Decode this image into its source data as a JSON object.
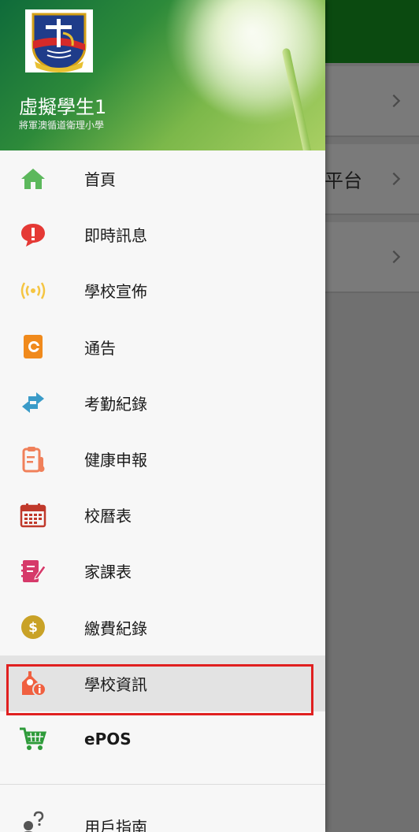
{
  "background": {
    "cards": [
      {
        "text": ""
      },
      {
        "text": "平台"
      },
      {
        "text": ""
      }
    ]
  },
  "drawer": {
    "user_name": "虛擬學生1",
    "school_name": "將軍澳循道衛理小學",
    "menu": [
      {
        "label": "首頁",
        "icon": "home-icon",
        "color": "#5cb85c"
      },
      {
        "label": "即時訊息",
        "icon": "alert-message-icon",
        "color": "#e53935"
      },
      {
        "label": "學校宣佈",
        "icon": "broadcast-icon",
        "color": "#f5c542"
      },
      {
        "label": "通告",
        "icon": "notice-icon",
        "color": "#f08a1c"
      },
      {
        "label": "考勤紀錄",
        "icon": "attendance-arrows-icon",
        "color": "#3a9bc8"
      },
      {
        "label": "健康申報",
        "icon": "health-clipboard-icon",
        "color": "#f0805a"
      },
      {
        "label": "校曆表",
        "icon": "calendar-icon",
        "color": "#c0392b"
      },
      {
        "label": "家課表",
        "icon": "homework-icon",
        "color": "#d63a6a"
      },
      {
        "label": "繳費紀錄",
        "icon": "payment-icon",
        "color": "#c9a227"
      },
      {
        "label": "學校資訊",
        "icon": "school-info-icon",
        "color": "#f06040"
      },
      {
        "label": "ePOS",
        "icon": "cart-icon",
        "color": "#2e9b3a"
      }
    ],
    "guide": {
      "label": "用戶指南",
      "icon": "user-guide-icon"
    }
  }
}
